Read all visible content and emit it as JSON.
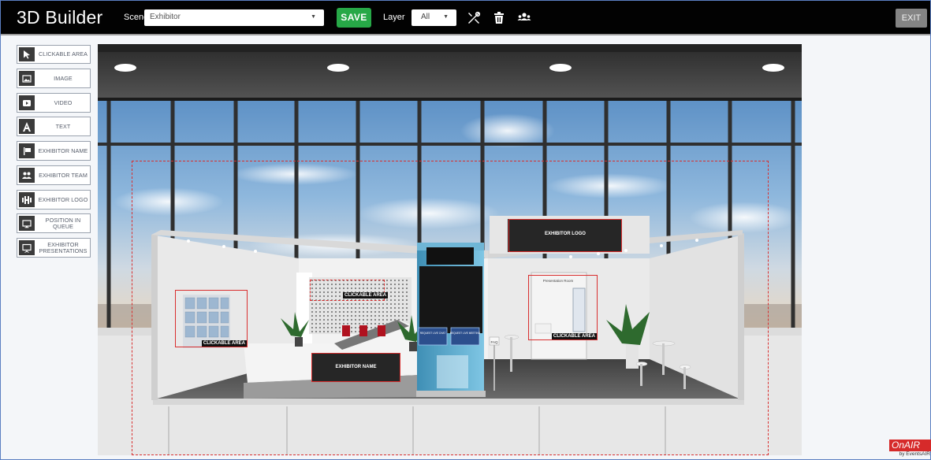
{
  "app": {
    "title": "3D Builder"
  },
  "toolbar": {
    "scene_label": "Scene",
    "scene_value": "Exhibitor",
    "save_label": "SAVE",
    "layer_label": "Layer",
    "layer_value": "All",
    "icons": [
      "tools-icon",
      "trash-icon",
      "team-icon"
    ],
    "exit_label": "EXIT"
  },
  "tools": [
    {
      "label": "CLICKABLE AREA",
      "icon": "cursor-icon"
    },
    {
      "label": "IMAGE",
      "icon": "image-icon"
    },
    {
      "label": "VIDEO",
      "icon": "video-icon"
    },
    {
      "label": "TEXT",
      "icon": "text-icon"
    },
    {
      "label": "EXHIBITOR NAME",
      "icon": "flag-icon"
    },
    {
      "label": "EXHIBITOR TEAM",
      "icon": "team-icon"
    },
    {
      "label": "EXHIBITOR LOGO",
      "icon": "logo-icon"
    },
    {
      "label": "POSITION IN QUEUE",
      "icon": "monitor-icon"
    },
    {
      "label": "EXHIBITOR PRESENTATIONS",
      "icon": "presentation-icon"
    }
  ],
  "scene": {
    "overlays": {
      "logo_label": "EXHIBITOR LOGO",
      "name_label": "EXHIBITOR NAME",
      "clickable_left": "CLICKABLE AREA",
      "clickable_wall": "CLICKABLE AREA",
      "clickable_right": "CLICKABLE AREA"
    },
    "room_sign": "Presentation Room",
    "kiosk_left": "REQUEST LIVE CHAT",
    "kiosk_right": "REQUEST LIVE MEETING",
    "faq_sign": "FAQ"
  },
  "brand": {
    "logo_text": "OnAIR",
    "sub_text": "by EventsAIR"
  },
  "colors": {
    "topbar": "#020202",
    "save": "#27a847",
    "exit": "#848484",
    "overlay": "#d92e2e"
  }
}
